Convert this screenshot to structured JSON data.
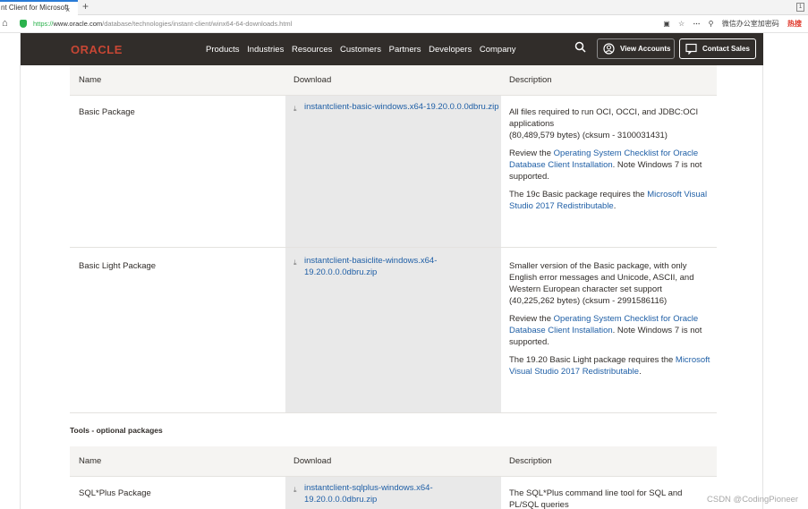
{
  "browser": {
    "tab_title": "nt Client for Microsoft",
    "tab_close": "×",
    "new_tab": "+",
    "window_button": "1",
    "url_scheme": "https://",
    "url_host": "www.oracle.com",
    "url_path": "/database/technologies/instant-client/winx64-64-downloads.html",
    "right_items": [
      "微信办公室加密码",
      "⋯"
    ],
    "hot_label": "热搜",
    "search_icon": "search-icon"
  },
  "nav": {
    "logo": "ORACLE",
    "links": [
      "Products",
      "Industries",
      "Resources",
      "Customers",
      "Partners",
      "Developers",
      "Company"
    ],
    "view_accounts": "View Accounts",
    "contact_sales": "Contact Sales"
  },
  "table1": {
    "headers": [
      "Name",
      "Download",
      "Description"
    ],
    "rows": [
      {
        "name": "Basic Package",
        "download": "instantclient-basic-windows.x64-19.20.0.0.0dbru.zip",
        "desc1": "All files required to run OCI, OCCI, and JDBC:OCI applications",
        "desc1b": "(80,489,579 bytes) (cksum - 3100031431)",
        "desc2_pre": "Review the ",
        "desc2_link": "Operating System Checklist for Oracle Database Client Installation",
        "desc2_post": ". Note Windows 7 is not supported.",
        "desc3_pre": "The 19c Basic package requires the ",
        "desc3_link": "Microsoft Visual Studio 2017 Redistributable",
        "desc3_post": "."
      },
      {
        "name": "Basic Light Package",
        "download": "instantclient-basiclite-windows.x64-19.20.0.0.0dbru.zip",
        "desc1": "Smaller version of the Basic package, with only English error messages and Unicode, ASCII, and Western European character set support",
        "desc1b": "(40,225,262 bytes) (cksum - 2991586116)",
        "desc2_pre": "Review the ",
        "desc2_link": "Operating System Checklist for Oracle Database Client Installation",
        "desc2_post": ". Note Windows 7 is not supported.",
        "desc3_pre": "The 19.20 Basic Light package requires the ",
        "desc3_link": "Microsoft Visual Studio 2017 Redistributable",
        "desc3_post": "."
      }
    ]
  },
  "tools": {
    "section_title": "Tools - optional packages",
    "headers": [
      "Name",
      "Download",
      "Description"
    ],
    "rows": [
      {
        "name": "SQL*Plus Package",
        "download": "instantclient-sqlplus-windows.x64-19.20.0.0.0dbru.zip",
        "desc1": "The SQL*Plus command line tool for SQL and PL/SQL queries"
      }
    ]
  },
  "watermark": "CSDN @CodingPioneer"
}
